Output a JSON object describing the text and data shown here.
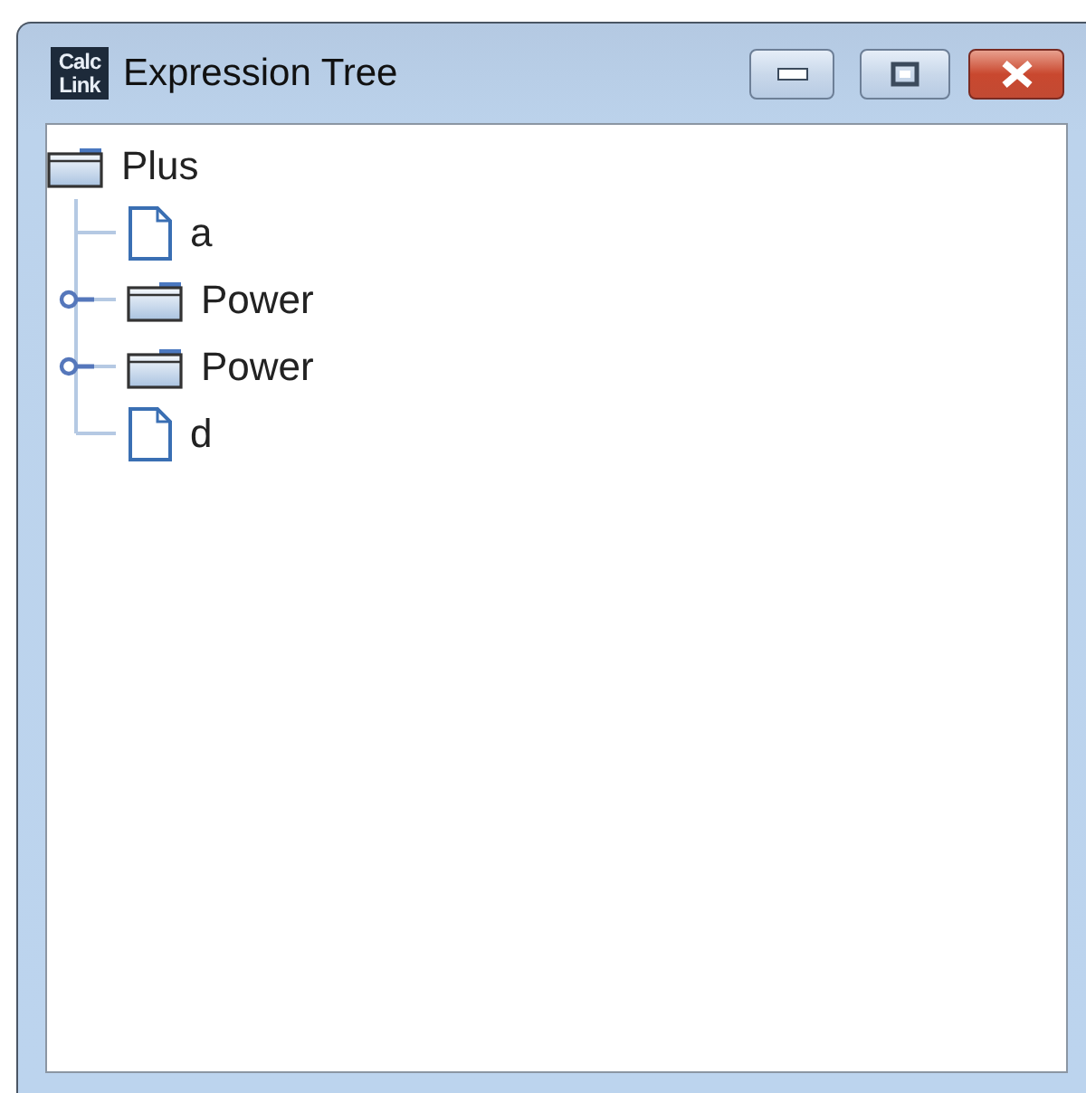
{
  "window": {
    "icon_text": [
      "Calc",
      "Link"
    ],
    "title": "Expression Tree"
  },
  "tree": {
    "label": "Plus",
    "kind": "folder",
    "children": [
      {
        "label": "a",
        "kind": "leaf"
      },
      {
        "label": "Power",
        "kind": "folder",
        "expanded": false
      },
      {
        "label": "Power",
        "kind": "folder",
        "expanded": false
      },
      {
        "label": "d",
        "kind": "leaf"
      }
    ]
  }
}
